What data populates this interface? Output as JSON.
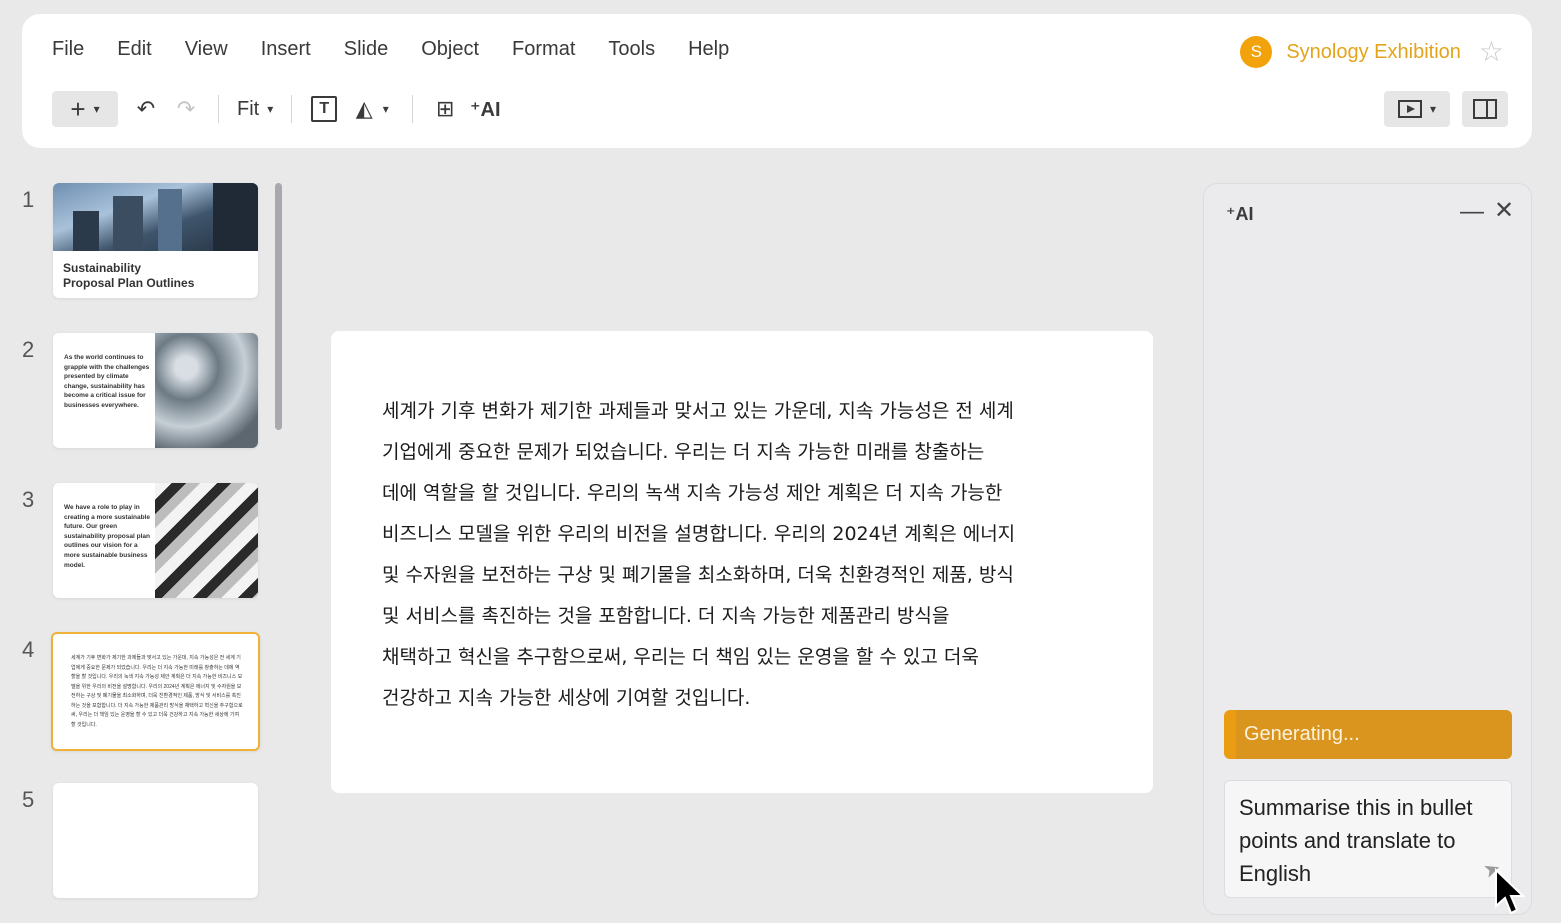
{
  "menu": [
    "File",
    "Edit",
    "View",
    "Insert",
    "Slide",
    "Object",
    "Format",
    "Tools",
    "Help"
  ],
  "document": {
    "avatar_letter": "S",
    "title": "Synology Exhibition"
  },
  "toolbar": {
    "add": "+",
    "undo": "↶",
    "redo": "↷",
    "zoom": "Fit",
    "textbox": "T",
    "ai_label": "⁺AI"
  },
  "slides": {
    "numbers": [
      "1",
      "2",
      "3",
      "4",
      "5"
    ],
    "thumb1_title": "Sustainability\nProposal Plan Outlines",
    "thumb2_text": "As the world continues to grapple with the challenges presented by climate change, sustainability has become a critical issue for businesses everywhere.",
    "thumb3_text": "We have a role to play in creating a more sustainable future. Our green sustainability proposal plan outlines our vision for a more sustainable business model.",
    "thumb4_text": "세계가 기후 변화가 제기한 과제들과 맞서고 있는 가운데, 지속 가능성은 전 세계 기업에게 중요한 문제가 되었습니다. 우리는 더 지속 가능한 미래를 창출하는 데에 역할을 할 것입니다. 우리의 녹색 지속 가능성 제안 계획은 더 지속 가능한 비즈니스 모델을 위한 우리의 비전을 설명합니다. 우리의 2024년 계획은 에너지 및 수자원을 보전하는 구상 및 폐기물을 최소화하며, 더욱 친환경적인 제품, 방식 및 서비스를 촉진하는 것을 포함합니다. 더 지속 가능한 제품관리 방식을 채택하고 혁신을 추구함으로써, 우리는 더 책임 있는 운영을 할 수 있고 더욱 건강하고 지속 가능한 세상에 기여할 것입니다."
  },
  "main_slide": {
    "text": "세계가 기후 변화가 제기한 과제들과 맞서고 있는 가운데, 지속 가능성은 전 세계\n기업에게 중요한 문제가 되었습니다. 우리는 더 지속 가능한 미래를 창출하는\n데에 역할을 할 것입니다. 우리의 녹색 지속 가능성 제안 계획은 더 지속 가능한\n비즈니스 모델을 위한 우리의 비전을 설명합니다. 우리의 2024년 계획은 에너지\n및 수자원을 보전하는 구상 및 폐기물을 최소화하며, 더욱 친환경적인 제품, 방식\n및 서비스를 촉진하는 것을 포함합니다. 더 지속 가능한 제품관리 방식을\n채택하고 혁신을 추구함으로써, 우리는 더 책임 있는 운영을 할 수 있고 더욱\n건강하고 지속 가능한 세상에 기여할 것입니다."
  },
  "ai_panel": {
    "badge": "⁺AI",
    "status": "Generating...",
    "prompt": "Summarise this in bullet points and translate to English"
  },
  "colors": {
    "accent": "#e3a41b",
    "generating": "#d9951d",
    "selected_border": "#f0b13a"
  }
}
